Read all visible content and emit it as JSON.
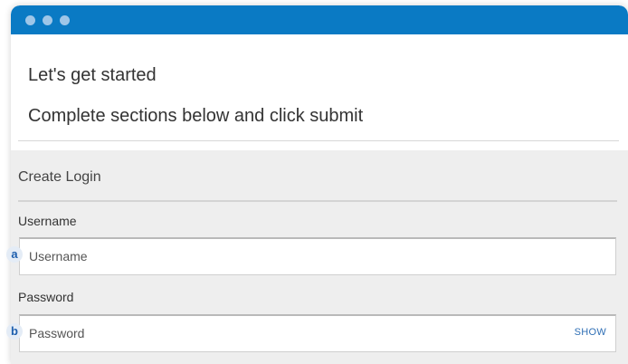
{
  "colors": {
    "titlebar": "#0a7ac4",
    "accent": "#2f6fb5"
  },
  "header": {
    "title": "Let's get started",
    "subtitle": "Complete sections below and click submit"
  },
  "section": {
    "title": "Create Login",
    "fields": [
      {
        "label": "Username",
        "placeholder": "Username",
        "value": "",
        "badge": "a"
      },
      {
        "label": "Password",
        "placeholder": "Password",
        "value": "",
        "badge": "b",
        "action": "SHOW"
      }
    ]
  }
}
